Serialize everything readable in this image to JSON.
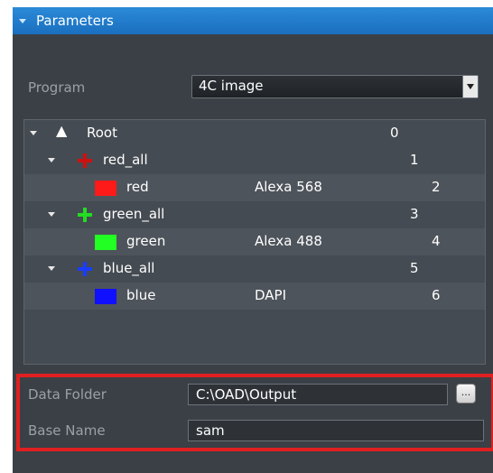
{
  "header": {
    "title": "Parameters"
  },
  "program": {
    "label": "Program",
    "value": "4C image"
  },
  "tree": {
    "rows": [
      {
        "name": "Root",
        "dye": "",
        "index": "0",
        "icon": "up-arrow-icon"
      },
      {
        "name": "red_all",
        "dye": "",
        "index": "1",
        "icon": "plus-icon",
        "color": "#cc1111"
      },
      {
        "name": "red",
        "dye": "Alexa 568",
        "index": "2",
        "icon": "color-swatch",
        "color": "#ff1a1a"
      },
      {
        "name": "green_all",
        "dye": "",
        "index": "3",
        "icon": "plus-icon",
        "color": "#22dd22"
      },
      {
        "name": "green",
        "dye": "Alexa 488",
        "index": "4",
        "icon": "color-swatch",
        "color": "#22ff22"
      },
      {
        "name": "blue_all",
        "dye": "",
        "index": "5",
        "icon": "plus-icon",
        "color": "#1a3cff"
      },
      {
        "name": "blue",
        "dye": "DAPI",
        "index": "6",
        "icon": "color-swatch",
        "color": "#1010ff"
      }
    ]
  },
  "output": {
    "data_folder_label": "Data Folder",
    "data_folder_value": "C:\\OAD\\Output",
    "browse_label": "...",
    "base_name_label": "Base Name",
    "base_name_value": "sam"
  }
}
